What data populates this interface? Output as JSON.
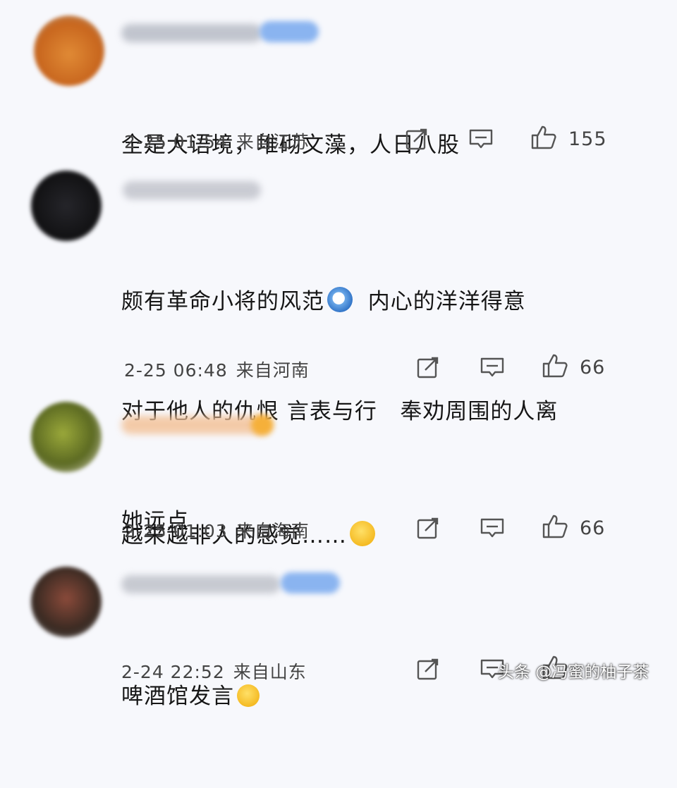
{
  "comments": [
    {
      "text_lines": [
        "全是大语境，堆砌文藻，人日八股"
      ],
      "date": "2-25 01:54",
      "location": "来自江苏",
      "likes": "155",
      "avatar_color": "#d9822f"
    },
    {
      "text_lines": [
        "颇有革命小将的风范",
        "对于他人的仇恨 言表与行   奉劝周围的人离",
        "她远点"
      ],
      "text_after_emoji": "  内心的洋洋得意",
      "date": "2-25 06:48",
      "location": "来自河南",
      "likes": "66",
      "avatar_color": "#1e1e22"
    },
    {
      "text_lines": [
        "越来越非人的感觉……"
      ],
      "date": "2-25 01:03",
      "location": "来自海南",
      "likes": "66",
      "avatar_color": "#7a8a2e"
    },
    {
      "text_lines": [
        "啤酒馆发言"
      ],
      "date": "2-24 22:52",
      "location": "来自山东",
      "avatar_color": "#3a2a22"
    }
  ],
  "watermark": "头条 @冯蜜的柚子茶",
  "icons": [
    "repost-icon",
    "comment-icon",
    "like-icon"
  ]
}
